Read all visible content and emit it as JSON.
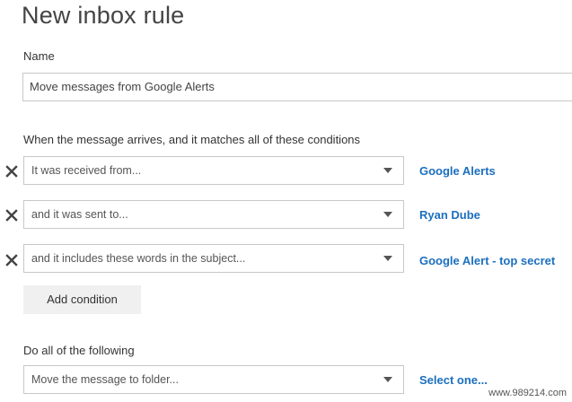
{
  "page": {
    "title": "New inbox rule"
  },
  "name_section": {
    "label": "Name",
    "value": "Move messages from Google Alerts"
  },
  "conditions_section": {
    "label": "When the message arrives, and it matches all of these conditions",
    "conditions": [
      {
        "selected": "It was received from...",
        "value": "Google Alerts",
        "remove_icon": "close-x-icon"
      },
      {
        "selected": "and it was sent to...",
        "value": "Ryan Dube",
        "remove_icon": "close-x-icon"
      },
      {
        "selected": "and it includes these words in the subject...",
        "value": "Google Alert - top secret",
        "remove_icon": "close-x-icon"
      }
    ],
    "add_label": "Add condition"
  },
  "actions_section": {
    "label": "Do all of the following",
    "actions": [
      {
        "selected": "Move the message to folder...",
        "value": "Select one..."
      }
    ]
  },
  "watermark": "www.989214.com",
  "colors": {
    "link": "#1b6fbf",
    "border": "#c8c8c8",
    "button_bg": "#f0f0f0",
    "text": "#333333"
  }
}
